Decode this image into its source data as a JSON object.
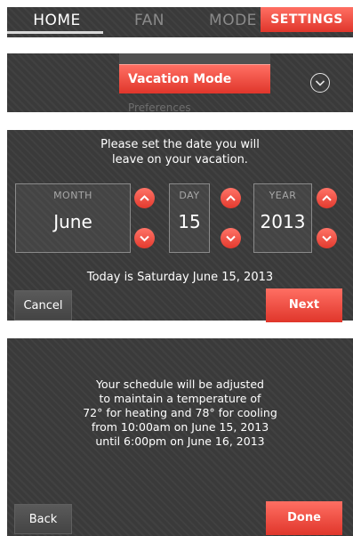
{
  "nav": {
    "tabs": [
      {
        "label": "HOME"
      },
      {
        "label": "FAN"
      },
      {
        "label": "MODE"
      },
      {
        "label": "SETTINGS"
      }
    ]
  },
  "menu": {
    "selected_label": "Vacation Mode",
    "next_label_partial": "Preferences",
    "expand_icon": "chevron-down-circle-icon"
  },
  "date_step": {
    "prompt_line1": "Please set the date you will",
    "prompt_line2": "leave on your vacation.",
    "month": {
      "label": "MONTH",
      "value": "June"
    },
    "day": {
      "label": "DAY",
      "value": "15"
    },
    "year": {
      "label": "YEAR",
      "value": "2013"
    },
    "today_text": "Today is Saturday June 15, 2013",
    "cancel_label": "Cancel",
    "next_label": "Next"
  },
  "confirm_step": {
    "line1": "Your schedule will be adjusted",
    "line2": "to maintain a temperature of",
    "line3": "72° for heating and 78° for cooling",
    "line4": "from 10:00am on June 15, 2013",
    "line5": "until 6:00pm on June 16, 2013",
    "back_label": "Back",
    "done_label": "Done"
  },
  "colors": {
    "accent": "#e8463a",
    "panel": "#3a3a3a"
  }
}
